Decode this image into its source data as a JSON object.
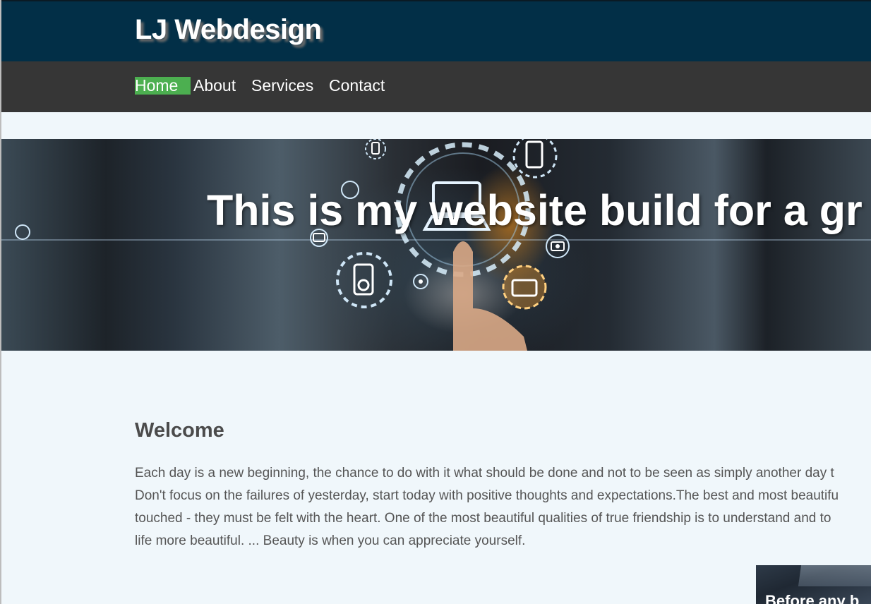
{
  "header": {
    "brand": "LJ Webdesign"
  },
  "nav": {
    "items": [
      {
        "label": "Home",
        "active": true
      },
      {
        "label": "About",
        "active": false
      },
      {
        "label": "Services",
        "active": false
      },
      {
        "label": "Contact",
        "active": false
      }
    ]
  },
  "hero": {
    "title": "This is my website build for a gr",
    "image_icons": [
      "laptop-icon",
      "phone-icon",
      "music-player-icon",
      "camera-icon",
      "tv-icon"
    ]
  },
  "welcome": {
    "heading": "Welcome",
    "lines": [
      "Each day is a new beginning, the chance to do with it what should be done and not to be seen as simply another day t",
      "Don't focus on the failures of yesterday, start today with positive thoughts and expectations.The best and most beautifu",
      "touched - they must be felt with the heart. One of the most beautiful qualities of true friendship is to understand and to",
      "life more beautiful. ... Beauty is when you can appreciate yourself."
    ]
  },
  "card": {
    "title": "Before any b"
  },
  "colors": {
    "header_bg": "#022f47",
    "nav_bg": "#363636",
    "nav_active": "#4caf50",
    "page_bg": "#f0f7fb"
  }
}
